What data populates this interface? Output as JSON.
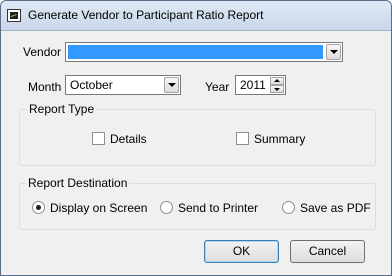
{
  "window": {
    "title": "Generate Vendor to Participant Ratio Report"
  },
  "vendor": {
    "label": "Vendor",
    "value": ""
  },
  "month": {
    "label": "Month",
    "value": "October"
  },
  "year": {
    "label": "Year",
    "value": "2011"
  },
  "report_type": {
    "title": "Report Type",
    "details": {
      "label": "Details",
      "checked": false
    },
    "summary": {
      "label": "Summary",
      "checked": false
    }
  },
  "report_destination": {
    "title": "Report Destination",
    "display_on_screen": {
      "label": "Display on Screen",
      "selected": true
    },
    "send_to_printer": {
      "label": "Send to Printer",
      "selected": false
    },
    "save_as_pdf": {
      "label": "Save as PDF",
      "selected": false
    }
  },
  "buttons": {
    "ok": "OK",
    "cancel": "Cancel"
  },
  "colors": {
    "selection": "#3399ff",
    "titlebar": "#c8d7ea",
    "dialog_bg": "#f0f0f0"
  }
}
